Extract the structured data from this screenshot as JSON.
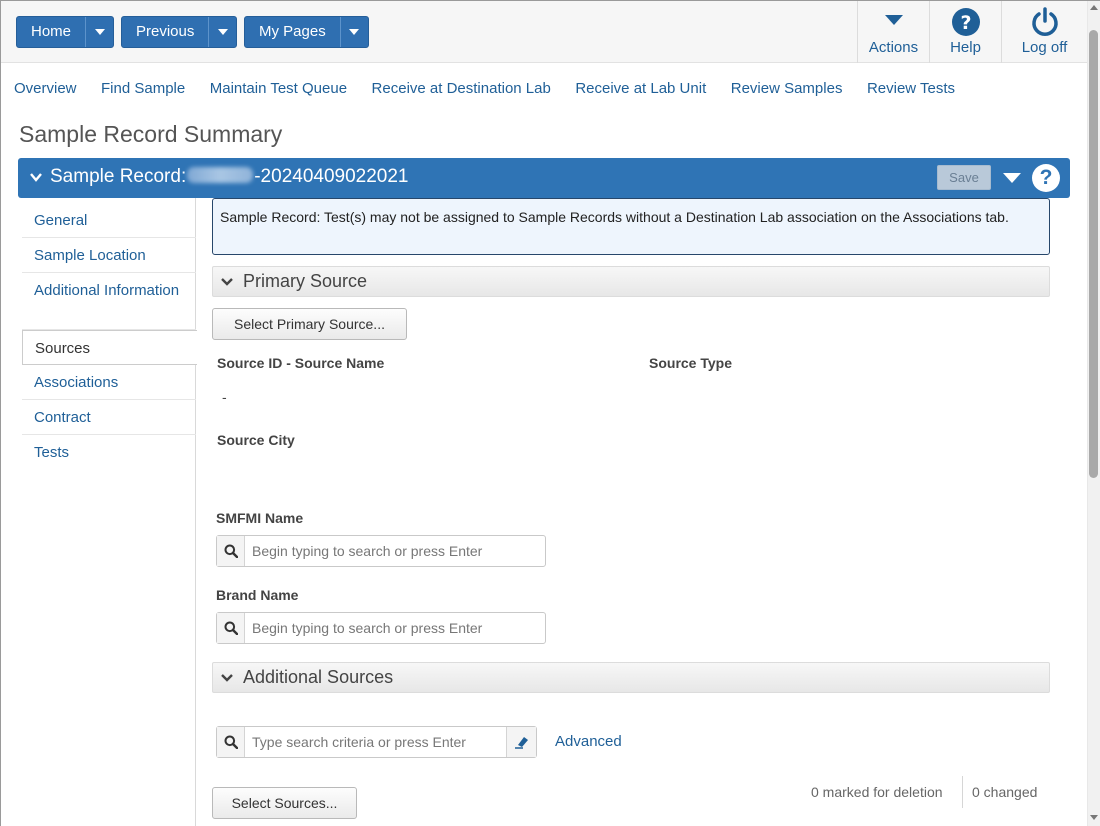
{
  "toolbar": {
    "home_label": "Home",
    "previous_label": "Previous",
    "mypages_label": "My Pages",
    "actions_label": "Actions",
    "help_label": "Help",
    "logoff_label": "Log off"
  },
  "nav": {
    "links": [
      "Overview",
      "Find Sample",
      "Maintain Test Queue",
      "Receive at Destination Lab",
      "Receive at Lab Unit",
      "Review Samples",
      "Review Tests"
    ]
  },
  "page": {
    "title": "Sample Record Summary"
  },
  "record": {
    "label": "Sample Record:",
    "id_suffix": "-20240409022021",
    "save_label": "Save",
    "help_glyph": "?"
  },
  "sidebar": {
    "items": [
      "General",
      "Sample Location",
      "Additional Information",
      "Sources",
      "Associations",
      "Contract",
      "Tests"
    ],
    "active": "Sources"
  },
  "notice": {
    "text": "Sample Record: Test(s) may not be assigned to Sample Records without a Destination Lab association on the Associations tab."
  },
  "primary_source": {
    "section_title": "Primary Source",
    "select_button": "Select Primary Source...",
    "source_id_label": "Source ID - Source Name",
    "source_id_value": "-",
    "source_type_label": "Source Type",
    "source_city_label": "Source City",
    "smfmi_label": "SMFMI Name",
    "smfmi_placeholder": "Begin typing to search or press Enter",
    "brand_label": "Brand Name",
    "brand_placeholder": "Begin typing to search or press Enter"
  },
  "additional_sources": {
    "section_title": "Additional Sources",
    "search_placeholder": "Type search criteria or press Enter",
    "advanced_label": "Advanced",
    "select_button": "Select Sources...",
    "marked_for_deletion": "0 marked for deletion",
    "changed": "0 changed"
  },
  "colors": {
    "primary": "#2f74b5",
    "link": "#1f5f97"
  }
}
